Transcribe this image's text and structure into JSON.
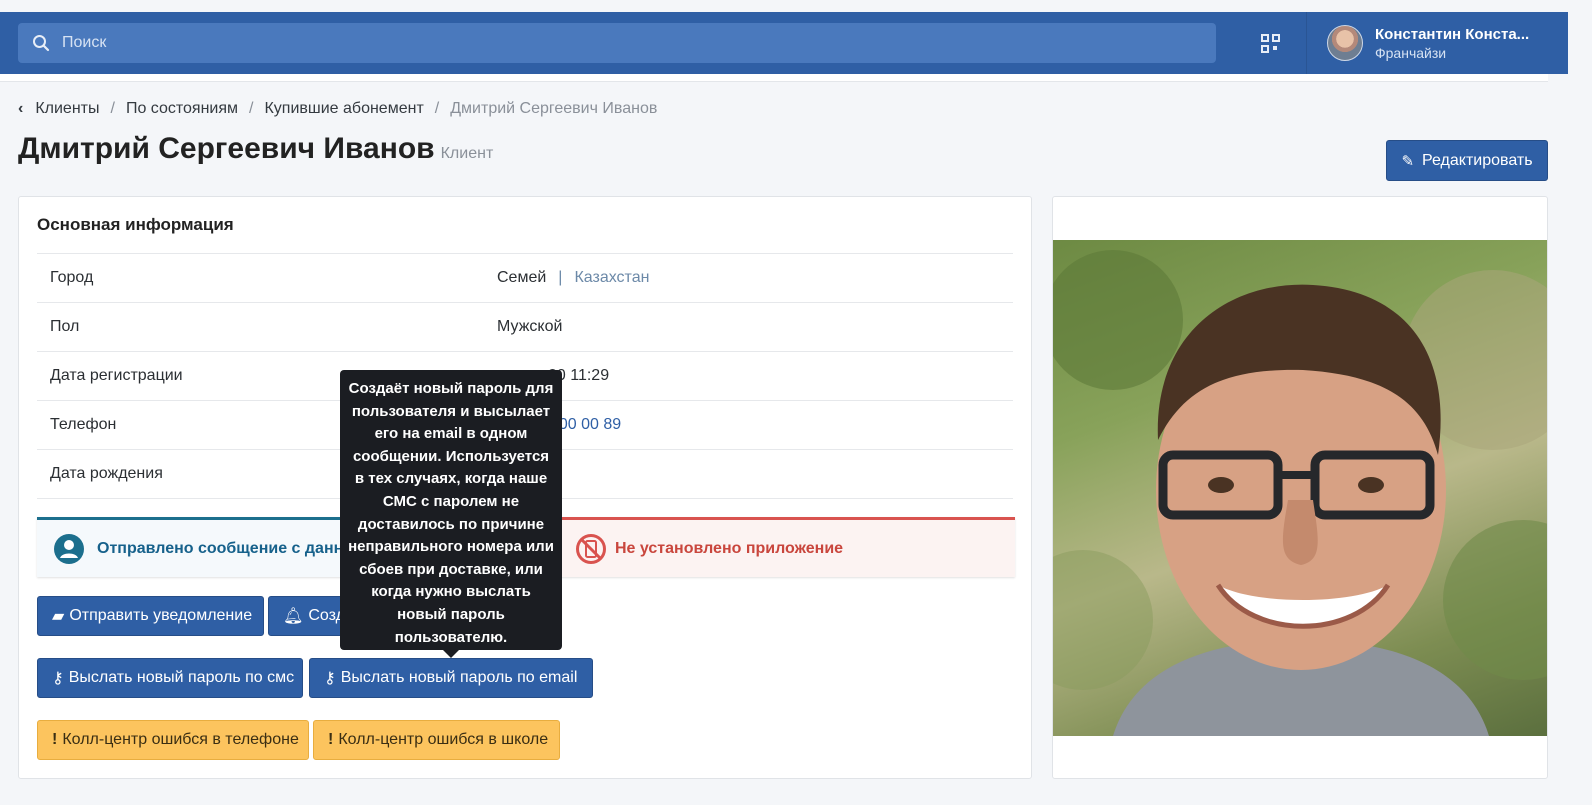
{
  "topbar": {
    "search_placeholder": "Поиск",
    "user_name": "Константин Конста...",
    "user_role": "Франчайзи"
  },
  "breadcrumb": {
    "items": [
      "Клиенты",
      "По состояниям",
      "Купившие абонемент"
    ],
    "current": "Дмитрий Сергеевич Иванов"
  },
  "page": {
    "title": "Дмитрий Сергеевич Иванов",
    "subtitle": "Клиент",
    "edit_label": "Редактировать"
  },
  "info": {
    "title": "Основная информация",
    "rows": [
      {
        "label": "Город",
        "value": "Семей",
        "extra": "Казахстан"
      },
      {
        "label": "Пол",
        "value": "Мужской"
      },
      {
        "label": "Дата регистрации",
        "value": "20 11:29"
      },
      {
        "label": "Телефон",
        "value": "900 00 89"
      },
      {
        "label": "Дата рождения",
        "value": ""
      }
    ]
  },
  "alerts": {
    "sent": "Отправлено сообщение с данным",
    "not_installed": "Не установлено приложение"
  },
  "buttons": {
    "send_notification": "Отправить уведомление",
    "create": "Созда",
    "send_password_sms": "Выслать новый пароль по смс",
    "send_password_email": "Выслать новый пароль по email",
    "callcenter_phone": "Колл-центр ошибся в телефоне",
    "callcenter_school": "Колл-центр ошибся в школе"
  },
  "tooltip": {
    "text": "Создаёт новый пароль для пользователя и высылает его на email в одном сообщении. Используется в тех случаях, когда наше СМС с паролем не доставилось по причине неправильного номера или сбоев при доставке, или когда нужно выслать новый пароль пользователю."
  },
  "colors": {
    "primary": "#2f5fa5",
    "warning": "#fcc45e",
    "danger": "#d9534f",
    "info": "#1c6f8d"
  }
}
